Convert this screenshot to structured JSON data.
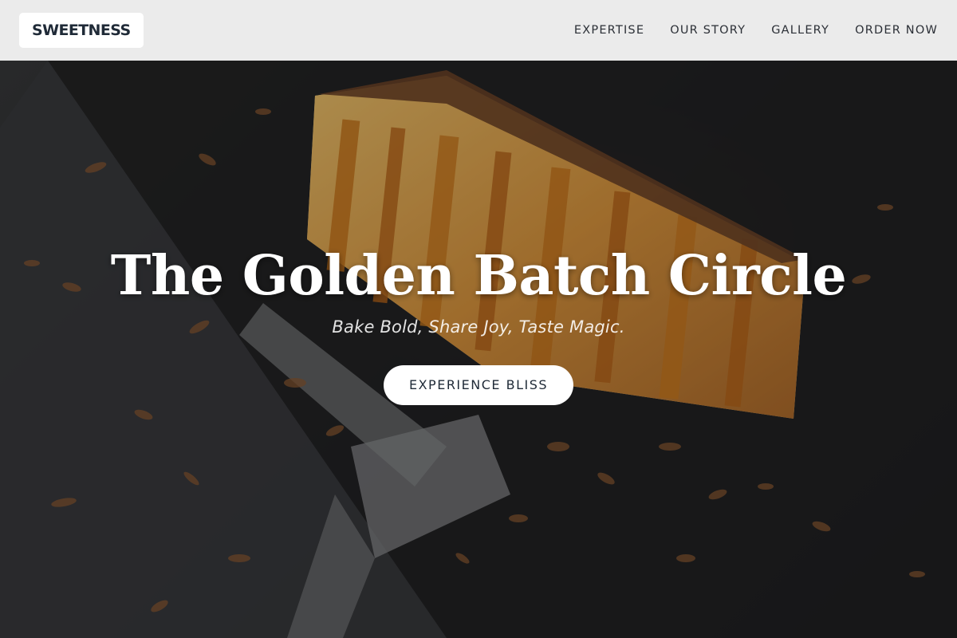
{
  "brand": {
    "logo_text": "SWEETNESS"
  },
  "nav": {
    "items": [
      {
        "label": "EXPERTISE"
      },
      {
        "label": "OUR STORY"
      },
      {
        "label": "GALLERY"
      },
      {
        "label": "ORDER NOW"
      }
    ]
  },
  "hero": {
    "title": "The Golden Batch Circle",
    "subtitle": "Bake Bold, Share Joy, Taste Magic.",
    "cta_label": "EXPERIENCE BLISS"
  },
  "colors": {
    "navbar_bg": "#ebebeb",
    "nav_text": "#2b2f36",
    "logo_text": "#1f2a37",
    "button_bg": "#ffffff",
    "button_text": "#1f2a37",
    "hero_text": "#ffffff"
  }
}
